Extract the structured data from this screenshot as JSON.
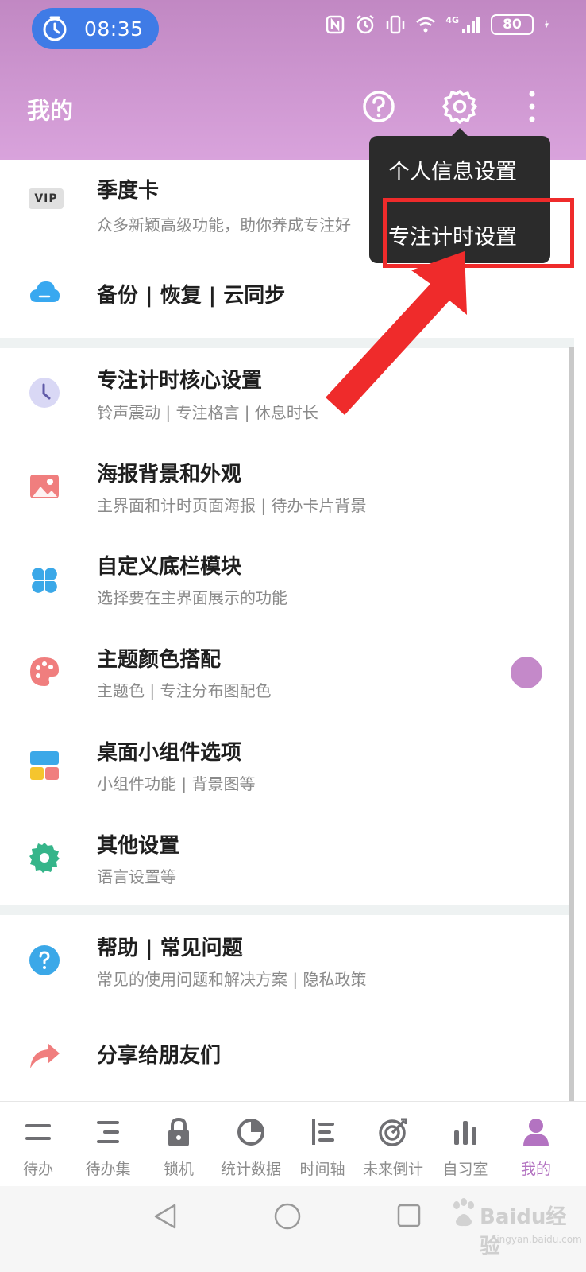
{
  "status_bar": {
    "time": "08:35",
    "network": "4G",
    "battery": "80"
  },
  "header": {
    "title": "我的"
  },
  "popup_menu": {
    "items": [
      "个人信息设置",
      "专注计时设置"
    ]
  },
  "list": {
    "vip": {
      "title": "季度卡",
      "sub": "众多新颖高级功能，助你养成专注好",
      "badge": "VIP"
    },
    "backup": {
      "title": "备份 | 恢复 | 云同步"
    },
    "focus": {
      "title": "专注计时核心设置",
      "sub": "铃声震动 | 专注格言 | 休息时长"
    },
    "poster": {
      "title": "海报背景和外观",
      "sub": "主界面和计时页面海报 | 待办卡片背景"
    },
    "bottom_bar": {
      "title": "自定义底栏模块",
      "sub": "选择要在主界面展示的功能"
    },
    "theme": {
      "title": "主题颜色搭配",
      "sub": "主题色 | 专注分布图配色",
      "color": "#c489c9"
    },
    "widget": {
      "title": "桌面小组件选项",
      "sub": "小组件功能 | 背景图等"
    },
    "other": {
      "title": "其他设置",
      "sub": "语言设置等"
    },
    "help": {
      "title": "帮助 | 常见问题",
      "sub": "常见的使用问题和解决方案 | 隐私政策"
    },
    "share": {
      "title": "分享给朋友们"
    }
  },
  "bottom_nav": {
    "items": [
      "待办",
      "待办集",
      "锁机",
      "统计数据",
      "时间轴",
      "未来倒计",
      "自习室",
      "我的"
    ],
    "active": "我的"
  },
  "watermark": {
    "text": "Baidu经验",
    "url": "jingyan.baidu.com"
  },
  "colors": {
    "accent": "#b373c1",
    "header_start": "#c188c3",
    "header_end": "#d9a3dc",
    "highlight": "#ef2b2b",
    "arrow": "#ef2b2b"
  }
}
